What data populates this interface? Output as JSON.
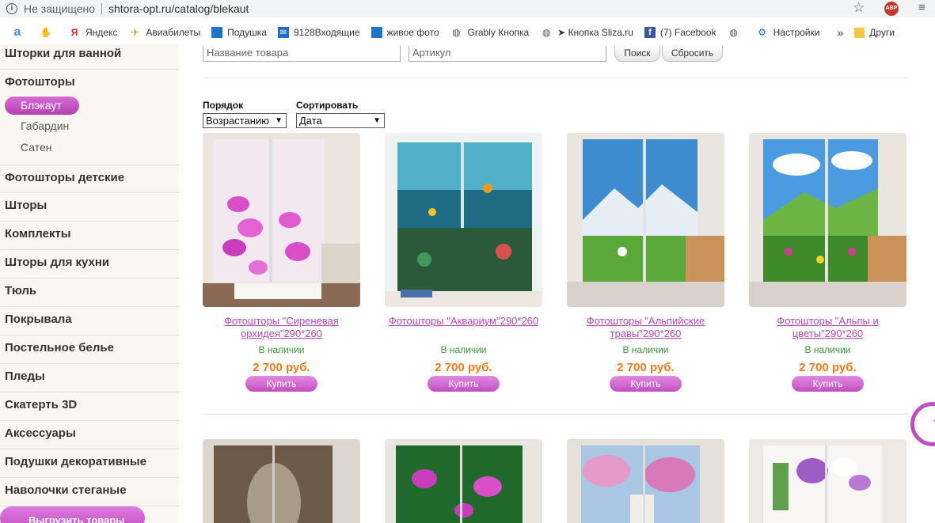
{
  "browser": {
    "insecure_label": "Не защищено",
    "url": "shtora-opt.ru/catalog/blekaut"
  },
  "bookmarks": [
    {
      "label": "",
      "icon": "a"
    },
    {
      "label": "",
      "icon": "hand"
    },
    {
      "label": "Яндекс",
      "icon": "Я"
    },
    {
      "label": "Авиабилеты",
      "icon": "✈"
    },
    {
      "label": "Подушка",
      "icon": "win"
    },
    {
      "label": "9128Входящие",
      "icon": "mail"
    },
    {
      "label": "живое фото",
      "icon": "win"
    },
    {
      "label": "Grably Кнопка",
      "icon": "globe"
    },
    {
      "label": "➤ Кнопка Sliza.ru",
      "icon": "globe"
    },
    {
      "label": "(7) Facebook",
      "icon": "f"
    },
    {
      "label": "",
      "icon": "globe"
    },
    {
      "label": "Настройки",
      "icon": "gear"
    }
  ],
  "bookmarks_overflow": "»",
  "bookmarks_other": "Други",
  "sidebar": {
    "top_item": "Шторки для ванной",
    "section": "Фотошторы",
    "active": "Блэкаут",
    "subs": [
      "Габардин",
      "Сатен"
    ],
    "items": [
      "Фотошторы детские",
      "Шторы",
      "Комплекты",
      "Шторы для кухни",
      "Тюль",
      "Покрывала",
      "Постельное белье",
      "Пледы",
      "Скатерть 3D",
      "Аксессуары",
      "Подушки декоративные",
      "Наволочки стеганые"
    ],
    "upload_button": "Выгрузить товары"
  },
  "filters": {
    "name_placeholder": "Название товара",
    "article_placeholder": "Артикул",
    "search": "Поиск",
    "reset": "Сбросить",
    "order_label": "Порядок",
    "order_value": "Возрастанию",
    "sort_label": "Сортировать",
    "sort_value": "Дата"
  },
  "products": [
    {
      "name": "Фотошторы \"Сиреневая орхидея\"290*260",
      "stock": "В наличии",
      "price": "2 700 руб.",
      "buy": "Купить"
    },
    {
      "name": "Фотошторы \"Аквариум\"290*260",
      "stock": "В наличии",
      "price": "2 700 руб.",
      "buy": "Купить"
    },
    {
      "name": "Фотошторы \"Альпийские травы\"290*260",
      "stock": "В наличии",
      "price": "2 700 руб.",
      "buy": "Купить"
    },
    {
      "name": "Фотошторы \"Альпы и цветы\"290*260",
      "stock": "В наличии",
      "price": "2 700 руб.",
      "buy": "Купить"
    }
  ],
  "colors": {
    "accent": "#c14ec0",
    "price": "#ec7b1b",
    "stock": "#3a9a3a"
  }
}
